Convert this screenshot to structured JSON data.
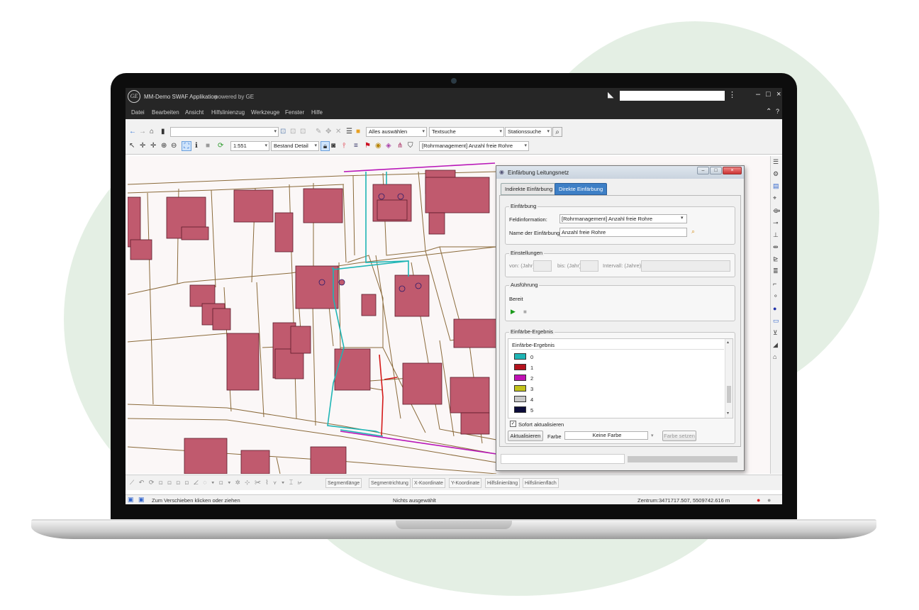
{
  "window": {
    "app_title": "MM-Demo SWAF Applikation",
    "powered_by": "powered by GE",
    "logo_text": "GE"
  },
  "menu": [
    "Datei",
    "Bearbeiten",
    "Ansicht",
    "Hilfslinienzug",
    "Werkzeuge",
    "Fenster",
    "Hilfe"
  ],
  "toolbar": {
    "select_all": "Alles auswählen",
    "text_search": "Textsuche",
    "station_search": "Stationssuche",
    "scale": "1:551",
    "layer_detail": "Bestand Detail",
    "coloring_layer": "[Rohrmanagement] Anzahl freie Rohre"
  },
  "bottom_toolbar": [
    "Segmentlänge",
    "Segmentrichtung",
    "X-Koordinate",
    "Y-Koordinate",
    "Hilfslinienläng",
    "Hilfslinienfläch"
  ],
  "status": {
    "hint": "Zum Verschieben klicken oder ziehen",
    "selection": "Nichts ausgewählt",
    "center": "Zentrum:3471717.507, 5509742.616 m"
  },
  "dialog": {
    "title": "Einfärbung Leitungsnetz",
    "tabs": [
      "Indirekte Einfärbung",
      "Direkte Einfärbung"
    ],
    "group_coloring": "Einfärbung",
    "field_info_label": "Feldinformation:",
    "field_info_value": "[Rohrmanagement] Anzahl freie Rohre",
    "name_label": "Name der Einfärbung:",
    "name_value": "Anzahl freie Rohre",
    "group_settings": "Einstellungen",
    "from_label": "von: (Jahr)",
    "to_label": "bis: (Jahr)",
    "interval_label": "Intervall: (Jahre)",
    "group_exec": "Ausführung",
    "exec_status": "Bereit",
    "group_result": "Einfärbe-Ergebnis",
    "result_header": "Einfärbe-Ergebnis",
    "legend": [
      {
        "label": "0",
        "color": "#1fb5b5"
      },
      {
        "label": "1",
        "color": "#b3121d"
      },
      {
        "label": "2",
        "color": "#c012b4"
      },
      {
        "label": "3",
        "color": "#c2c21a"
      },
      {
        "label": "4",
        "color": "#c8c8c8"
      },
      {
        "label": "5",
        "color": "#0c0c3a"
      }
    ],
    "auto_update": "Sofort aktualisieren",
    "update_button": "Aktualisieren",
    "color_label": "Farbe",
    "color_value": "Keine Farbe",
    "set_color_button": "Farbe setzen"
  },
  "colors": {
    "building": "#c05a6e",
    "parcel": "#8a6a3a",
    "pipe_cyan": "#1fb5b5",
    "pipe_red": "#d41a1a",
    "pipe_magenta": "#b815b8"
  }
}
